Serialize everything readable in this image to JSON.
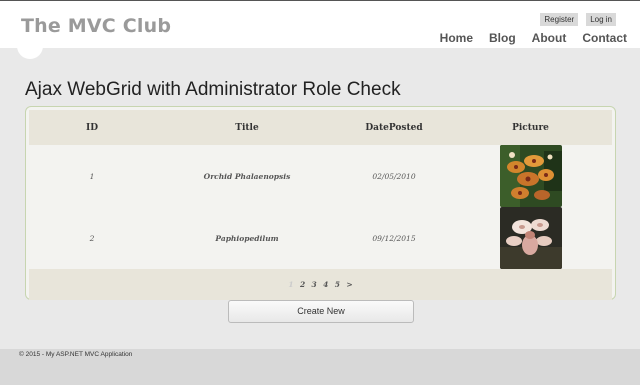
{
  "header": {
    "site_title": "The MVC Club",
    "register_label": "Register",
    "login_label": "Log in",
    "nav": [
      "Home",
      "Blog",
      "About",
      "Contact"
    ]
  },
  "page": {
    "heading": "Ajax WebGrid with Administrator Role Check"
  },
  "grid": {
    "columns": [
      "ID",
      "Title",
      "DatePosted",
      "Picture"
    ],
    "rows": [
      {
        "id": "1",
        "title": "Orchid Phalaenopsis",
        "date": "02/05/2010",
        "picture": "orchid-phalaenopsis-photo"
      },
      {
        "id": "2",
        "title": "Paphiopedilum",
        "date": "09/12/2015",
        "picture": "paphiopedilum-photo"
      }
    ],
    "pager": [
      "1",
      "2",
      "3",
      "4",
      "5",
      ">"
    ],
    "current_page": "1"
  },
  "actions": {
    "create_label": "Create New"
  },
  "footer": {
    "text": "© 2015 - My ASP.NET MVC Application"
  },
  "colors": {
    "header_bg": "#ffffff",
    "page_bg": "#e9e9e9",
    "grid_header_bg": "#e8e5da",
    "grid_border": "#c7d5b0",
    "footer_bg": "#d8d8d8"
  }
}
